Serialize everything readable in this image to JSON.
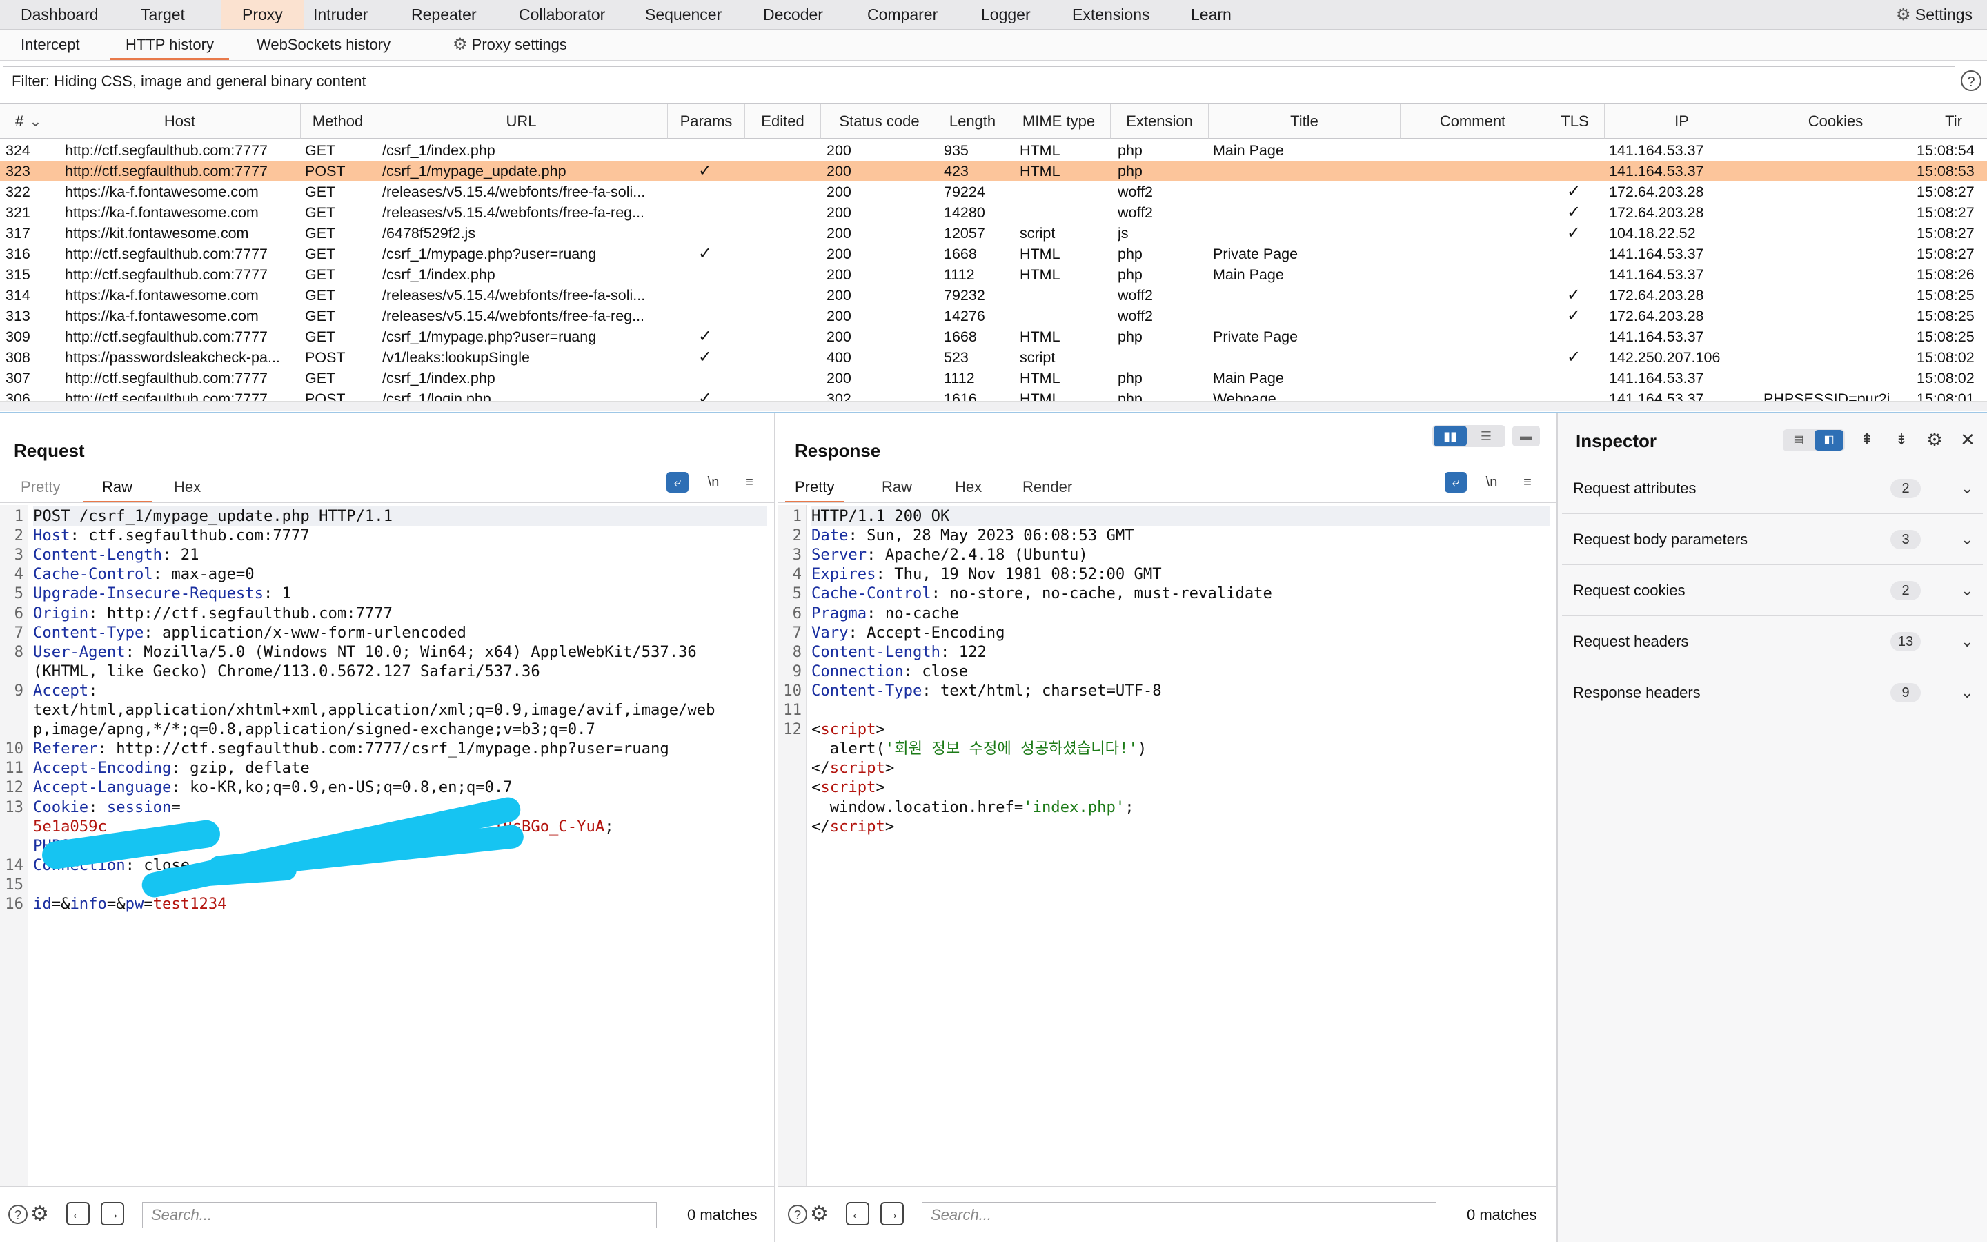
{
  "nav": {
    "tabs": [
      "Dashboard",
      "Target",
      "Proxy",
      "Intruder",
      "Repeater",
      "Collaborator",
      "Sequencer",
      "Decoder",
      "Comparer",
      "Logger",
      "Extensions",
      "Learn"
    ],
    "active": "Proxy",
    "settings": "Settings"
  },
  "proxy_tabs": {
    "intercept": "Intercept",
    "http_history": "HTTP history",
    "websockets": "WebSockets history",
    "proxy_settings": "Proxy settings"
  },
  "filter": {
    "text": "Filter: Hiding CSS, image and general binary content",
    "help": "?"
  },
  "table": {
    "columns": [
      "#",
      "Host",
      "Method",
      "URL",
      "Params",
      "Edited",
      "Status code",
      "Length",
      "MIME type",
      "Extension",
      "Title",
      "Comment",
      "TLS",
      "IP",
      "Cookies",
      "Tir"
    ],
    "sort_indicator": "⌄",
    "check": "✓",
    "rows": [
      {
        "id": "324",
        "host": "http://ctf.segfaulthub.com:7777",
        "method": "GET",
        "url": "/csrf_1/index.php",
        "params": false,
        "status": "200",
        "length": "935",
        "mime": "HTML",
        "ext": "php",
        "title": "Main Page",
        "tls": false,
        "ip": "141.164.53.37",
        "cookies": "",
        "time": "15:08:54",
        "selected": false
      },
      {
        "id": "323",
        "host": "http://ctf.segfaulthub.com:7777",
        "method": "POST",
        "url": "/csrf_1/mypage_update.php",
        "params": true,
        "status": "200",
        "length": "423",
        "mime": "HTML",
        "ext": "php",
        "title": "",
        "tls": false,
        "ip": "141.164.53.37",
        "cookies": "",
        "time": "15:08:53",
        "selected": true
      },
      {
        "id": "322",
        "host": "https://ka-f.fontawesome.com",
        "method": "GET",
        "url": "/releases/v5.15.4/webfonts/free-fa-soli...",
        "params": false,
        "status": "200",
        "length": "79224",
        "mime": "",
        "ext": "woff2",
        "title": "",
        "tls": true,
        "ip": "172.64.203.28",
        "cookies": "",
        "time": "15:08:27",
        "selected": false
      },
      {
        "id": "321",
        "host": "https://ka-f.fontawesome.com",
        "method": "GET",
        "url": "/releases/v5.15.4/webfonts/free-fa-reg...",
        "params": false,
        "status": "200",
        "length": "14280",
        "mime": "",
        "ext": "woff2",
        "title": "",
        "tls": true,
        "ip": "172.64.203.28",
        "cookies": "",
        "time": "15:08:27",
        "selected": false
      },
      {
        "id": "317",
        "host": "https://kit.fontawesome.com",
        "method": "GET",
        "url": "/6478f529f2.js",
        "params": false,
        "status": "200",
        "length": "12057",
        "mime": "script",
        "ext": "js",
        "title": "",
        "tls": true,
        "ip": "104.18.22.52",
        "cookies": "",
        "time": "15:08:27",
        "selected": false
      },
      {
        "id": "316",
        "host": "http://ctf.segfaulthub.com:7777",
        "method": "GET",
        "url": "/csrf_1/mypage.php?user=ruang",
        "params": true,
        "status": "200",
        "length": "1668",
        "mime": "HTML",
        "ext": "php",
        "title": "Private Page",
        "tls": false,
        "ip": "141.164.53.37",
        "cookies": "",
        "time": "15:08:27",
        "selected": false
      },
      {
        "id": "315",
        "host": "http://ctf.segfaulthub.com:7777",
        "method": "GET",
        "url": "/csrf_1/index.php",
        "params": false,
        "status": "200",
        "length": "1112",
        "mime": "HTML",
        "ext": "php",
        "title": "Main Page",
        "tls": false,
        "ip": "141.164.53.37",
        "cookies": "",
        "time": "15:08:26",
        "selected": false
      },
      {
        "id": "314",
        "host": "https://ka-f.fontawesome.com",
        "method": "GET",
        "url": "/releases/v5.15.4/webfonts/free-fa-soli...",
        "params": false,
        "status": "200",
        "length": "79232",
        "mime": "",
        "ext": "woff2",
        "title": "",
        "tls": true,
        "ip": "172.64.203.28",
        "cookies": "",
        "time": "15:08:25",
        "selected": false
      },
      {
        "id": "313",
        "host": "https://ka-f.fontawesome.com",
        "method": "GET",
        "url": "/releases/v5.15.4/webfonts/free-fa-reg...",
        "params": false,
        "status": "200",
        "length": "14276",
        "mime": "",
        "ext": "woff2",
        "title": "",
        "tls": true,
        "ip": "172.64.203.28",
        "cookies": "",
        "time": "15:08:25",
        "selected": false
      },
      {
        "id": "309",
        "host": "http://ctf.segfaulthub.com:7777",
        "method": "GET",
        "url": "/csrf_1/mypage.php?user=ruang",
        "params": true,
        "status": "200",
        "length": "1668",
        "mime": "HTML",
        "ext": "php",
        "title": "Private Page",
        "tls": false,
        "ip": "141.164.53.37",
        "cookies": "",
        "time": "15:08:25",
        "selected": false
      },
      {
        "id": "308",
        "host": "https://passwordsleakcheck-pa...",
        "method": "POST",
        "url": "/v1/leaks:lookupSingle",
        "params": true,
        "status": "400",
        "length": "523",
        "mime": "script",
        "ext": "",
        "title": "",
        "tls": true,
        "ip": "142.250.207.106",
        "cookies": "",
        "time": "15:08:02",
        "selected": false
      },
      {
        "id": "307",
        "host": "http://ctf.segfaulthub.com:7777",
        "method": "GET",
        "url": "/csrf_1/index.php",
        "params": false,
        "status": "200",
        "length": "1112",
        "mime": "HTML",
        "ext": "php",
        "title": "Main Page",
        "tls": false,
        "ip": "141.164.53.37",
        "cookies": "",
        "time": "15:08:02",
        "selected": false
      },
      {
        "id": "306",
        "host": "http://ctf.segfaulthub.com:7777",
        "method": "POST",
        "url": "/csrf_1/login.php",
        "params": true,
        "status": "302",
        "length": "1616",
        "mime": "HTML",
        "ext": "php",
        "title": "Webpage",
        "tls": false,
        "ip": "141.164.53.37",
        "cookies": "PHPSESSID=pur2i",
        "time": "15:08:01",
        "selected": false
      }
    ]
  },
  "request": {
    "title": "Request",
    "tabs": [
      "Pretty",
      "Raw",
      "Hex"
    ],
    "active_tab": "Raw",
    "newline_toggle": "\\n",
    "lines": [
      {
        "n": "1",
        "parts": [
          {
            "t": "POST /csrf_1/mypage_update.php HTTP/1.1",
            "c": "v"
          }
        ]
      },
      {
        "n": "2",
        "parts": [
          {
            "t": "Host",
            "c": "k"
          },
          {
            "t": ": ctf.segfaulthub.com:7777",
            "c": "v"
          }
        ]
      },
      {
        "n": "3",
        "parts": [
          {
            "t": "Content-Length",
            "c": "k"
          },
          {
            "t": ": 21",
            "c": "v"
          }
        ]
      },
      {
        "n": "4",
        "parts": [
          {
            "t": "Cache-Control",
            "c": "k"
          },
          {
            "t": ": max-age=0",
            "c": "v"
          }
        ]
      },
      {
        "n": "5",
        "parts": [
          {
            "t": "Upgrade-Insecure-Requests",
            "c": "k"
          },
          {
            "t": ": 1",
            "c": "v"
          }
        ]
      },
      {
        "n": "6",
        "parts": [
          {
            "t": "Origin",
            "c": "k"
          },
          {
            "t": ": http://ctf.segfaulthub.com:7777",
            "c": "v"
          }
        ]
      },
      {
        "n": "7",
        "parts": [
          {
            "t": "Content-Type",
            "c": "k"
          },
          {
            "t": ": application/x-www-form-urlencoded",
            "c": "v"
          }
        ]
      },
      {
        "n": "8",
        "parts": [
          {
            "t": "User-Agent",
            "c": "k"
          },
          {
            "t": ": Mozilla/5.0 (Windows NT 10.0; Win64; x64) AppleWebKit/537.36",
            "c": "v"
          }
        ]
      },
      {
        "n": "",
        "parts": [
          {
            "t": "(KHTML, like Gecko) Chrome/113.0.5672.127 Safari/537.36",
            "c": "v"
          }
        ]
      },
      {
        "n": "9",
        "parts": [
          {
            "t": "Accept",
            "c": "k"
          },
          {
            "t": ":",
            "c": "v"
          }
        ]
      },
      {
        "n": "",
        "parts": [
          {
            "t": "text/html,application/xhtml+xml,application/xml;q=0.9,image/avif,image/web",
            "c": "v"
          }
        ]
      },
      {
        "n": "",
        "parts": [
          {
            "t": "p,image/apng,*/*;q=0.8,application/signed-exchange;v=b3;q=0.7",
            "c": "v"
          }
        ]
      },
      {
        "n": "10",
        "parts": [
          {
            "t": "Referer",
            "c": "k"
          },
          {
            "t": ": http://ctf.segfaulthub.com:7777/csrf_1/mypage.php?user=ruang",
            "c": "v"
          }
        ]
      },
      {
        "n": "11",
        "parts": [
          {
            "t": "Accept-Encoding",
            "c": "k"
          },
          {
            "t": ": gzip, deflate",
            "c": "v"
          }
        ]
      },
      {
        "n": "12",
        "parts": [
          {
            "t": "Accept-Language",
            "c": "k"
          },
          {
            "t": ": ko-KR,ko;q=0.9,en-US;q=0.8,en;q=0.7",
            "c": "v"
          }
        ]
      },
      {
        "n": "13",
        "parts": [
          {
            "t": "Cookie",
            "c": "k"
          },
          {
            "t": ": ",
            "c": "v"
          },
          {
            "t": "session",
            "c": "k"
          },
          {
            "t": "=",
            "c": "v"
          }
        ]
      },
      {
        "n": "",
        "parts": [
          {
            "t": "5e1a059c                                          IRsBGo_C-YuA",
            "c": "red"
          },
          {
            "t": ";",
            "c": "v"
          }
        ]
      },
      {
        "n": "",
        "parts": [
          {
            "t": "PHPSESSID",
            "c": "k"
          },
          {
            "t": "=",
            "c": "v"
          },
          {
            "t": "pur2",
            "c": "red"
          }
        ]
      },
      {
        "n": "14",
        "parts": [
          {
            "t": "Connection",
            "c": "k"
          },
          {
            "t": ": close",
            "c": "v"
          }
        ]
      },
      {
        "n": "15",
        "parts": []
      },
      {
        "n": "16",
        "parts": [
          {
            "t": "id",
            "c": "k"
          },
          {
            "t": "=&",
            "c": "v"
          },
          {
            "t": "info",
            "c": "k"
          },
          {
            "t": "=&",
            "c": "v"
          },
          {
            "t": "pw",
            "c": "k"
          },
          {
            "t": "=",
            "c": "v"
          },
          {
            "t": "test1234",
            "c": "red"
          }
        ]
      }
    ],
    "search_placeholder": "Search...",
    "matches": "0 matches"
  },
  "response": {
    "title": "Response",
    "tabs": [
      "Pretty",
      "Raw",
      "Hex",
      "Render"
    ],
    "active_tab": "Pretty",
    "newline_toggle": "\\n",
    "lines": [
      {
        "n": "1",
        "parts": [
          {
            "t": "HTTP/1.1 200 OK",
            "c": "v"
          }
        ]
      },
      {
        "n": "2",
        "parts": [
          {
            "t": "Date",
            "c": "k"
          },
          {
            "t": ": Sun, 28 May 2023 06:08:53 GMT",
            "c": "v"
          }
        ]
      },
      {
        "n": "3",
        "parts": [
          {
            "t": "Server",
            "c": "k"
          },
          {
            "t": ": Apache/2.4.18 (Ubuntu)",
            "c": "v"
          }
        ]
      },
      {
        "n": "4",
        "parts": [
          {
            "t": "Expires",
            "c": "k"
          },
          {
            "t": ": Thu, 19 Nov 1981 08:52:00 GMT",
            "c": "v"
          }
        ]
      },
      {
        "n": "5",
        "parts": [
          {
            "t": "Cache-Control",
            "c": "k"
          },
          {
            "t": ": no-store, no-cache, must-revalidate",
            "c": "v"
          }
        ]
      },
      {
        "n": "6",
        "parts": [
          {
            "t": "Pragma",
            "c": "k"
          },
          {
            "t": ": no-cache",
            "c": "v"
          }
        ]
      },
      {
        "n": "7",
        "parts": [
          {
            "t": "Vary",
            "c": "k"
          },
          {
            "t": ": Accept-Encoding",
            "c": "v"
          }
        ]
      },
      {
        "n": "8",
        "parts": [
          {
            "t": "Content-Length",
            "c": "k"
          },
          {
            "t": ": 122",
            "c": "v"
          }
        ]
      },
      {
        "n": "9",
        "parts": [
          {
            "t": "Connection",
            "c": "k"
          },
          {
            "t": ": close",
            "c": "v"
          }
        ]
      },
      {
        "n": "10",
        "parts": [
          {
            "t": "Content-Type",
            "c": "k"
          },
          {
            "t": ": text/html; charset=UTF-8",
            "c": "v"
          }
        ]
      },
      {
        "n": "11",
        "parts": []
      },
      {
        "n": "12",
        "parts": [
          {
            "t": "<",
            "c": "v"
          },
          {
            "t": "script",
            "c": "tag"
          },
          {
            "t": ">",
            "c": "v"
          }
        ]
      },
      {
        "n": "",
        "parts": [
          {
            "t": "  alert(",
            "c": "v"
          },
          {
            "t": "'회원 정보 수정에 성공하셨습니다!'",
            "c": "grn"
          },
          {
            "t": ")",
            "c": "v"
          }
        ]
      },
      {
        "n": "",
        "parts": [
          {
            "t": "</",
            "c": "v"
          },
          {
            "t": "script",
            "c": "tag"
          },
          {
            "t": ">",
            "c": "v"
          }
        ]
      },
      {
        "n": "",
        "parts": [
          {
            "t": "<",
            "c": "v"
          },
          {
            "t": "script",
            "c": "tag"
          },
          {
            "t": ">",
            "c": "v"
          }
        ]
      },
      {
        "n": "",
        "parts": [
          {
            "t": "  window.location.href=",
            "c": "v"
          },
          {
            "t": "'index.php'",
            "c": "grn"
          },
          {
            "t": ";",
            "c": "v"
          }
        ]
      },
      {
        "n": "",
        "parts": [
          {
            "t": "</",
            "c": "v"
          },
          {
            "t": "script",
            "c": "tag"
          },
          {
            "t": ">",
            "c": "v"
          }
        ]
      }
    ],
    "search_placeholder": "Search...",
    "matches": "0 matches"
  },
  "inspector": {
    "title": "Inspector",
    "sections": [
      {
        "label": "Request attributes",
        "count": "2"
      },
      {
        "label": "Request body parameters",
        "count": "3"
      },
      {
        "label": "Request cookies",
        "count": "2"
      },
      {
        "label": "Request headers",
        "count": "13"
      },
      {
        "label": "Response headers",
        "count": "9"
      }
    ]
  },
  "colors": {
    "accent": "#e8794a",
    "selected_row": "#fcc59b",
    "header_key": "#1a2fa0",
    "value_red": "#b3130d",
    "string_green": "#1b7a16",
    "redaction": "#16c4f2"
  }
}
